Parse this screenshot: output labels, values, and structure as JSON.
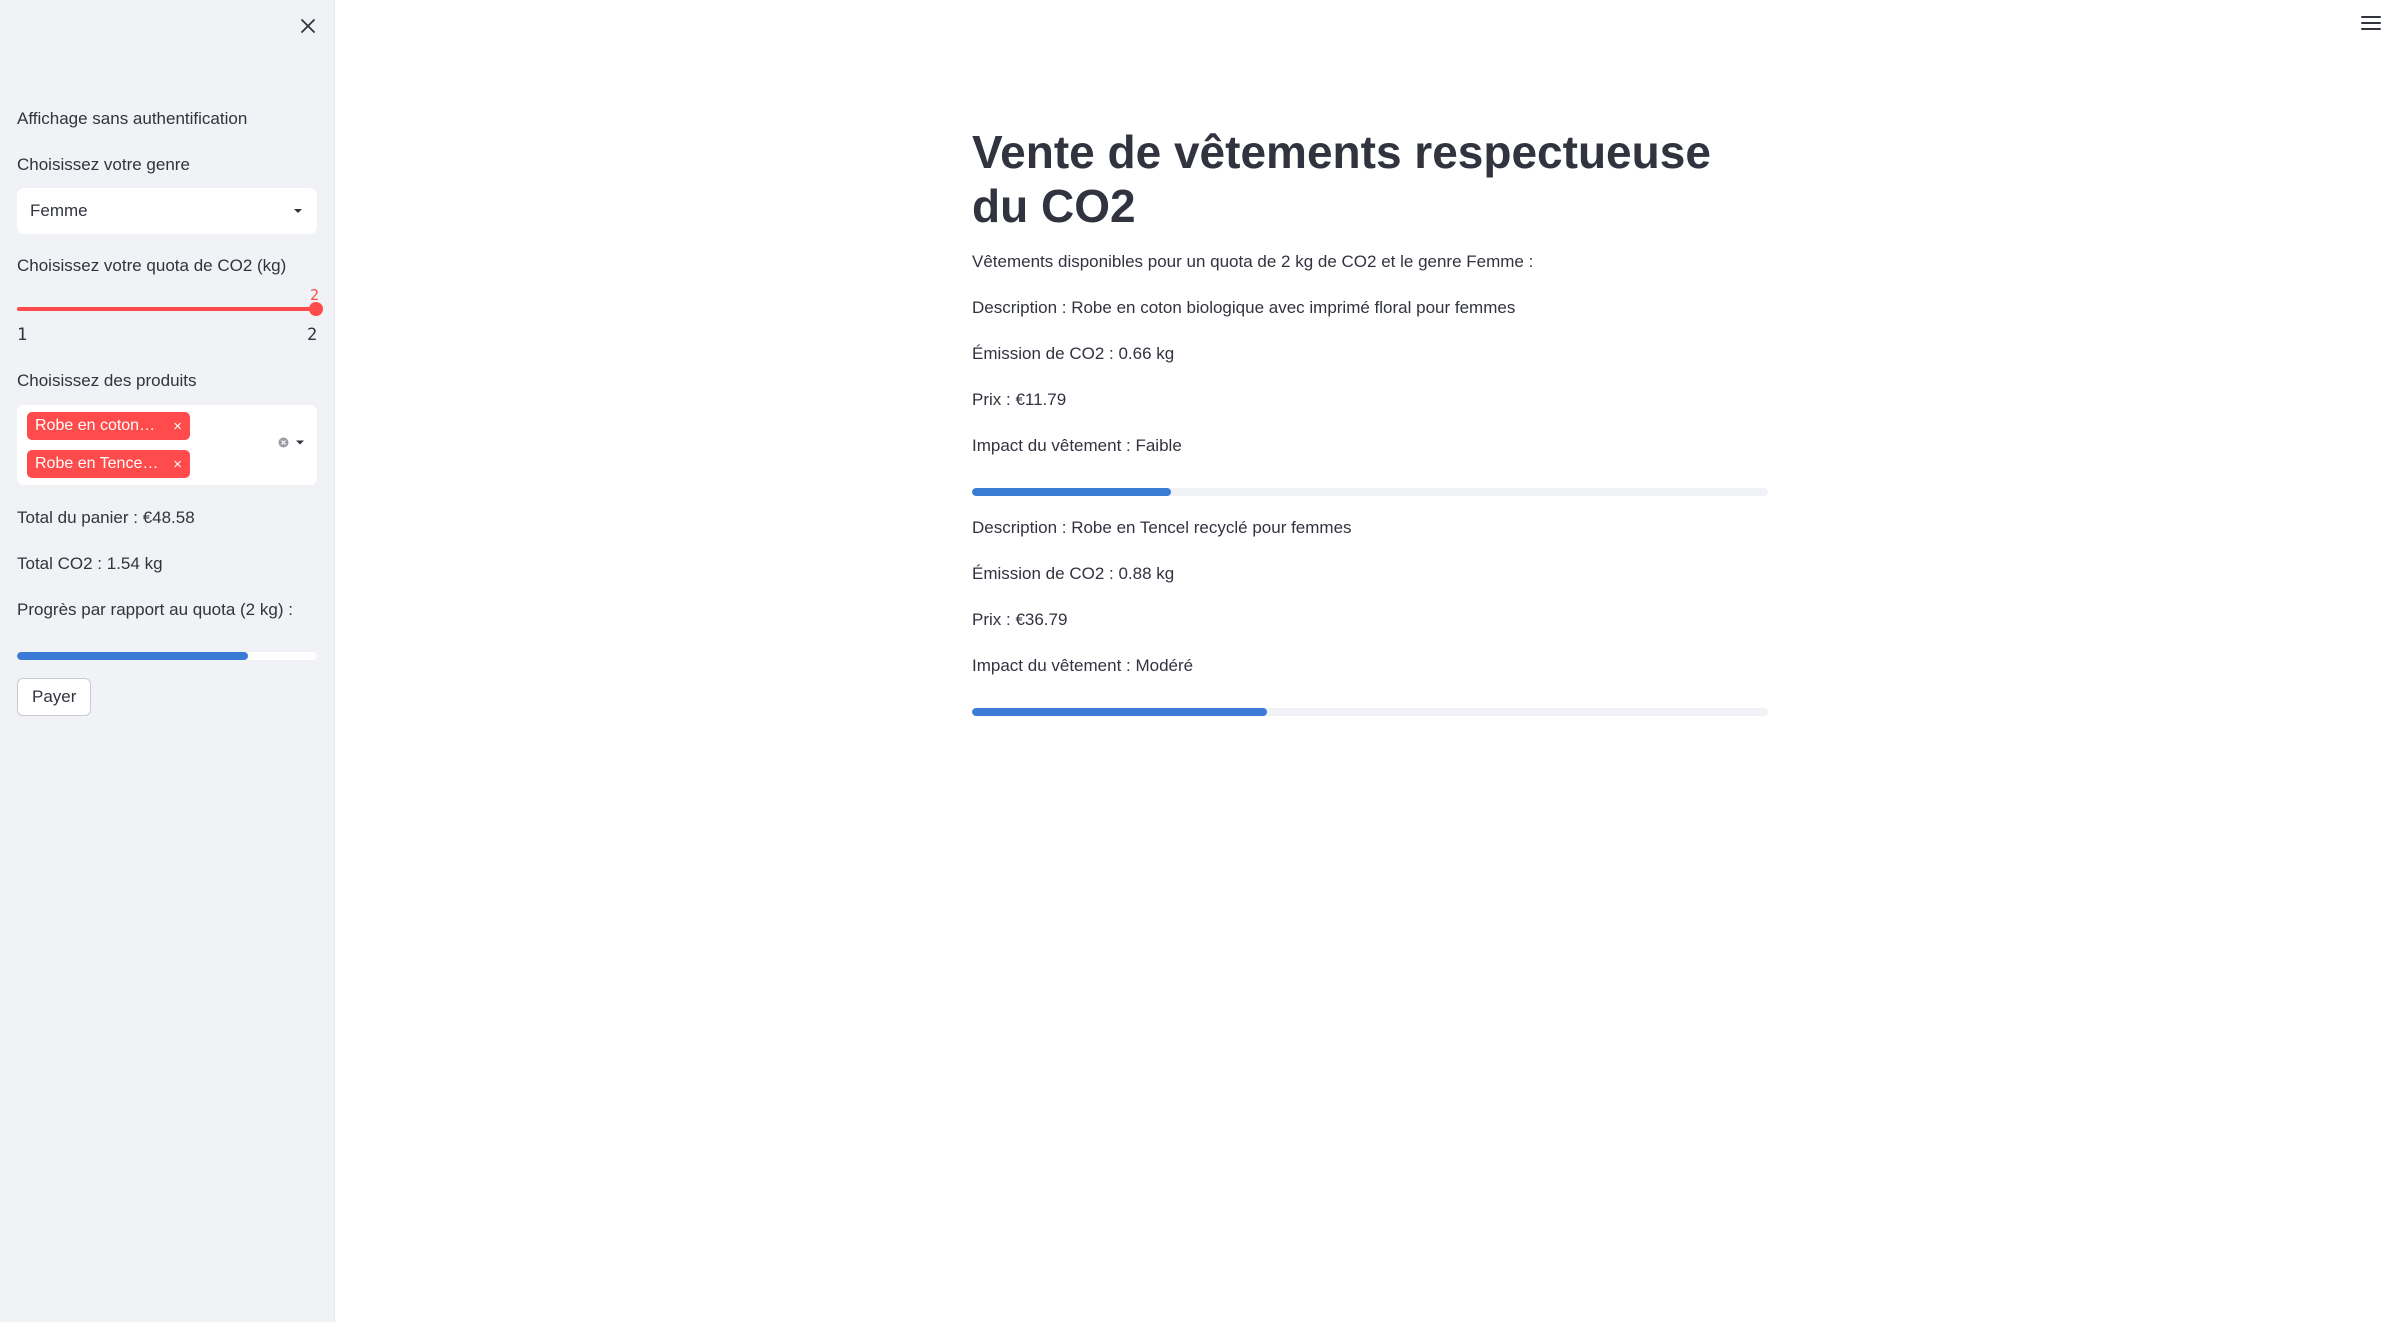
{
  "sidebar": {
    "auth_label": "Affichage sans authentification",
    "gender_label": "Choisissez votre genre",
    "gender_value": "Femme",
    "quota_label": "Choisissez votre quota de CO2 (kg)",
    "quota_value": "2",
    "quota_min": "1",
    "quota_max": "2",
    "products_label": "Choisissez des produits",
    "selected_products": [
      "Robe en coton…",
      "Robe en Tence…"
    ],
    "total_cart": "Total du panier : €48.58",
    "total_co2": "Total CO2 : 1.54 kg",
    "progress_label": "Progrès par rapport au quota (2 kg) :",
    "progress_fraction": 0.77,
    "pay_label": "Payer"
  },
  "main": {
    "title": "Vente de vêtements respectueuse du CO2",
    "intro": "Vêtements disponibles pour un quota de 2 kg de CO2 et le genre Femme :",
    "products": [
      {
        "description": "Description : Robe en coton biologique avec imprimé floral pour femmes",
        "emission": "Émission de CO2 : 0.66 kg",
        "price": "Prix : €11.79",
        "impact": "Impact du vêtement : Faible",
        "progress_fraction": 0.25
      },
      {
        "description": "Description : Robe en Tencel recyclé pour femmes",
        "emission": "Émission de CO2 : 0.88 kg",
        "price": "Prix : €36.79",
        "impact": "Impact du vêtement : Modéré",
        "progress_fraction": 0.37
      }
    ]
  },
  "colors": {
    "accent": "#ff4b4b",
    "progress": "#3a7bd5",
    "sidebar_bg": "#f0f2f6",
    "text": "#31333f"
  },
  "icons": [
    "close-icon",
    "menu-icon",
    "chevron-down-icon",
    "clear-icon"
  ]
}
